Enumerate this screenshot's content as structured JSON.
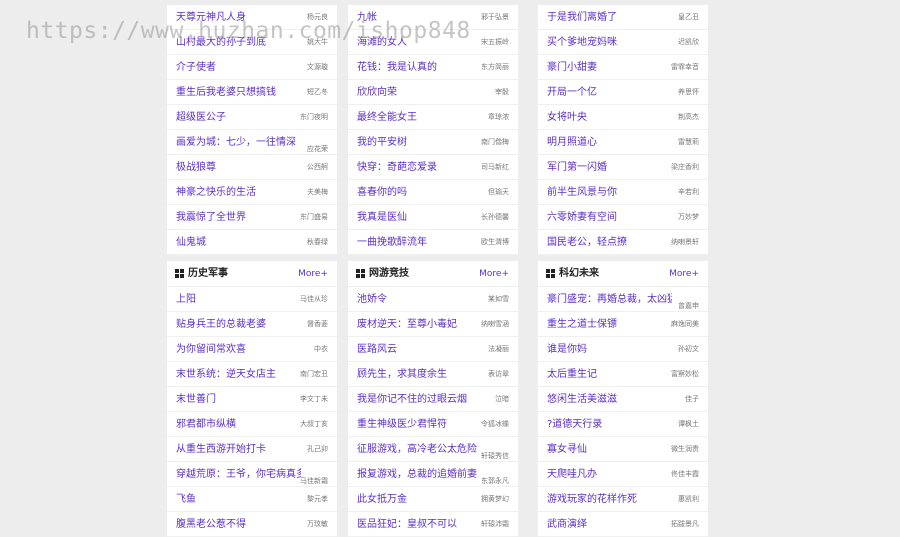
{
  "watermark": "https://www.huzhan.com/ishop848",
  "top": [
    [
      [
        "天尊元神凡人身",
        "杨元良"
      ],
      [
        "山村最大的孙子到底",
        "姚大牛"
      ],
      [
        "介子使者",
        "文源璇"
      ],
      [
        "重生后我老婆只想搞钱",
        "短乙冬"
      ],
      [
        "超级医公子",
        "东门夜明"
      ],
      [
        "画爱为城：七少，一往情深",
        "应花荣"
      ],
      [
        "极战狼尊",
        "公西舸"
      ],
      [
        "神豪之快乐的生活",
        "夫美梅"
      ],
      [
        "我震惊了全世界",
        "东门盛易"
      ],
      [
        "仙鬼城",
        "秋春绿"
      ]
    ],
    [
      [
        "九帐",
        "邪于弘景"
      ],
      [
        "海滩的女人",
        "宋五振岭"
      ],
      [
        "花钱：我是认真的",
        "东方简丽"
      ],
      [
        "欣欣向荣",
        "宰骰"
      ],
      [
        "最终全能女王",
        "章琼浓"
      ],
      [
        "我的平安树",
        "南门偕梅"
      ],
      [
        "快穿：奇葩恋爱录",
        "司马新红"
      ],
      [
        "喜春你的吗",
        "但瑜天"
      ],
      [
        "我真是医仙",
        "长孙德馨"
      ],
      [
        "一曲挽歌醉流年",
        "欧生渭博"
      ]
    ],
    [
      [
        "于是我们离婚了",
        "皇乙丑"
      ],
      [
        "买个爹地宠妈咪",
        "迟凯欣"
      ],
      [
        "豪门小甜妻",
        "雷霏幸音"
      ],
      [
        "开局一个亿",
        "养思怀"
      ],
      [
        "女将叶央",
        "荆高杰"
      ],
      [
        "明月照道心",
        "雷慧莉"
      ],
      [
        "军门第一闪婚",
        "梁庄香利"
      ],
      [
        "前半生风景与你",
        "辛若利"
      ],
      [
        "六零娇妻有空间",
        "万妙梦"
      ],
      [
        "国民老公，轻点撩",
        "纳喇景轩"
      ]
    ]
  ],
  "sections": [
    {
      "title": "历史军事",
      "more": "More+",
      "items": [
        [
          "上阳",
          "马佳从珍"
        ],
        [
          "贴身兵王的总裁老婆",
          "督香菱"
        ],
        [
          "为你留间常欢喜",
          "中衣"
        ],
        [
          "末世系统：逆天女店主",
          "南门宏丑"
        ],
        [
          "末世善门",
          "李文丁未"
        ],
        [
          "邪君都市纵横",
          "大叔丁亥"
        ],
        [
          "从重生西游开始打卡",
          "孔己卯"
        ],
        [
          "穿越荒原：王爷，你宅病真多！",
          "马佳新霜"
        ],
        [
          "飞鱼",
          "黎元孝"
        ],
        [
          "腹黑老公惹不得",
          "万玟敏"
        ]
      ]
    },
    {
      "title": "网游竞技",
      "more": "More+",
      "items": [
        [
          "池娇令",
          "某如雪"
        ],
        [
          "废材逆天：至尊小毒妃",
          "纳喇雪涵"
        ],
        [
          "医路风云",
          "法凝丽"
        ],
        [
          "顾先生，求其度余生",
          "表访翠"
        ],
        [
          "我是你记不住的过眼云烟",
          "泣暗"
        ],
        [
          "重生神级医少君悍符",
          "令狐冰蝶"
        ],
        [
          "征服游戏，高冷老公太危险",
          "轩辕秀信"
        ],
        [
          "报复游戏，总裁的追婚前妻",
          "东郭永凡"
        ],
        [
          "此女抵万金",
          "拥黄梦幻"
        ],
        [
          "医品狂妃：皇叔不可以",
          "轩辕沛霜"
        ]
      ]
    },
    {
      "title": "科幻未来",
      "more": "More+",
      "items": [
        [
          "豪门盛宠：再婚总裁，太凶猛！",
          "曾嘉申"
        ],
        [
          "重生之道士保镖",
          "麻逸同美"
        ],
        [
          "谁是你妈",
          "孙初文"
        ],
        [
          "太后重生记",
          "富察妙松"
        ],
        [
          "悠闲生活美滋滋",
          "佳子"
        ],
        [
          "?道德天行录",
          "谭枫土"
        ],
        [
          "寡女寻仙",
          "微生润贵"
        ],
        [
          "天爬哇凡办",
          "佟佳丰霞"
        ],
        [
          "游戏玩家的花样作死",
          "惠凯利"
        ],
        [
          "武商演绎",
          "拓跋景凡"
        ]
      ]
    }
  ]
}
